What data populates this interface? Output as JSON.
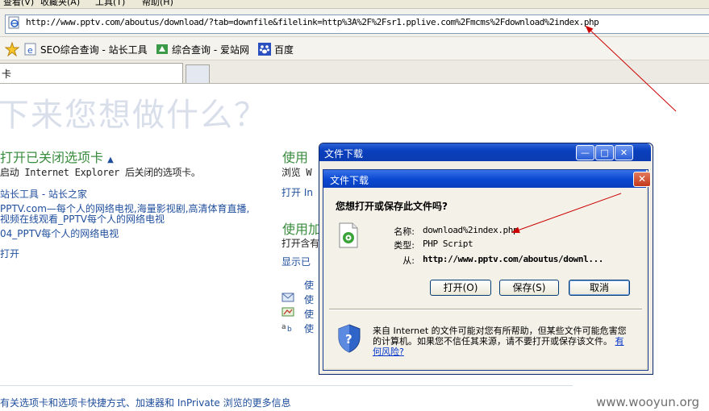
{
  "menu": {
    "items": [
      "查看(V)",
      "收藏夹(A)",
      "工具(T)",
      "帮助(H)"
    ]
  },
  "address": {
    "url": "http://www.pptv.com/aboutus/download/?tab=downfile&filelink=http%3A%2F%2Fsr1.pplive.com%2Fmcms%2Fdownload%2index.php"
  },
  "favorites": {
    "items": [
      "SEO综合查询 - 站长工具",
      "综合查询 - 爱站网",
      "百度"
    ]
  },
  "tabs": {
    "active_label": "卡"
  },
  "page": {
    "headline": "下来您想做什么？",
    "left": {
      "reopen_title": "打开已关闭选项卡",
      "reopen_desc": "启动 Internet Explorer 后关闭的选项卡。",
      "links": [
        "站长工具 - 站长之家",
        "PPTV.com—每个人的网络电视,海量影视剧,高清体育直播,",
        "视频在线观看_PPTV每个人的网络电视",
        "04_PPTV每个人的网络电视"
      ],
      "open_label": "打开"
    },
    "right": {
      "use_title": "使用",
      "browse_text": "浏览 W",
      "open_in": "打开 In",
      "use2_title": "使用加",
      "open_with": "打开含有",
      "show": "显示已",
      "items": [
        "使",
        "使",
        "使",
        "使"
      ]
    },
    "footer_link": "有关选项卡和选项卡快捷方式、加速器和 InPrivate 浏览的更多信息",
    "watermark": "www.wooyun.org"
  },
  "outer_dialog": {
    "title": "文件下载"
  },
  "dialog": {
    "title": "文件下载",
    "question": "您想打开或保存此文件吗?",
    "name_label": "名称:",
    "name_value": "download%2index.php",
    "type_label": "类型:",
    "type_value": "PHP Script",
    "from_label": "从:",
    "from_value": "http://www.pptv.com/aboutus/downl...",
    "open_button": "打开(O)",
    "save_button": "保存(S)",
    "cancel_button": "取消",
    "warning_text": "来自 Internet 的文件可能对您有所帮助，但某些文件可能危害您的计算机。如果您不信任其来源，请不要打开或保存该文件。",
    "risk_link": "有何风险?"
  },
  "colors": {
    "title_bar": "#0a3fbe",
    "accent_green": "#3a8c3e",
    "link_blue": "#1f4e9c",
    "annotation_red": "#cc0000"
  }
}
